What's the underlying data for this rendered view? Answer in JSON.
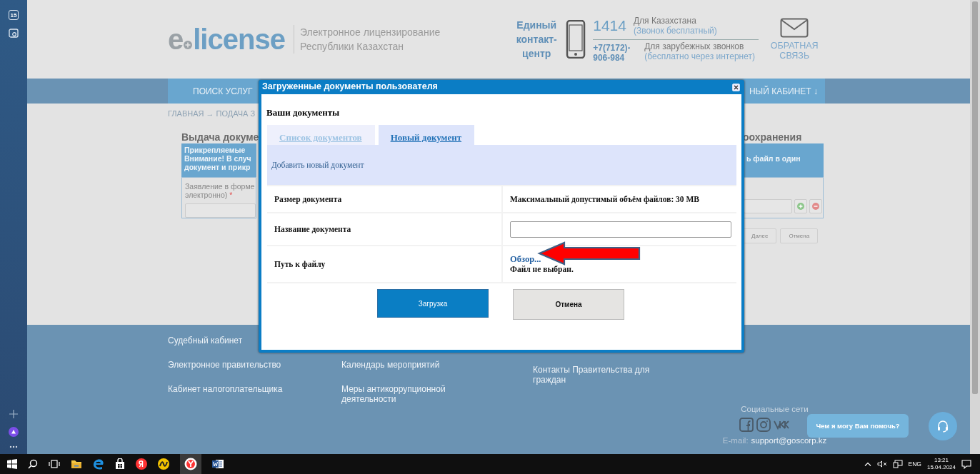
{
  "sidebar": {
    "badge": "15"
  },
  "header": {
    "logo": {
      "prefix": "e",
      "name": "license"
    },
    "subtitle": [
      "Электронное лицензирование",
      "Республики Казахстан"
    ],
    "contact": {
      "title": "Единый контакт-центр",
      "short_number": "1414",
      "short_note": "Для Казахстана",
      "short_hint": "(Звонок бесплатный)",
      "long_number": [
        "+7(7172)-",
        "906-984"
      ],
      "long_note": "Для зарубежных звонков",
      "long_hint": "(бесплатно через интернет)"
    },
    "feedback": "ОБРАТНАЯ СВЯЗЬ"
  },
  "nav": {
    "left": "ПОИСК УСЛУГ",
    "right": "НЫЙ КАБИНЕТ ↓"
  },
  "breadcrumb": "ГЛАВНАЯ → ПОДАЧА З",
  "background_form": {
    "left_title": "Выдача докуме",
    "left_notice": [
      "Прикрепляемые",
      "Внимание! В случ",
      "документ и прикр"
    ],
    "left_label": "Заявление в форме",
    "left_label_2": "электронно)",
    "required_mark": "*",
    "right_title": "оохранения",
    "right_notice": "ь файл в один",
    "buttons": [
      "Далее",
      "Отмена"
    ]
  },
  "modal": {
    "title": "Загруженные документы пользователя",
    "heading": "Ваши документы",
    "tabs": [
      {
        "label": "Список документов",
        "selected": false
      },
      {
        "label": "Новый документ",
        "selected": true
      }
    ],
    "panel_link": "Добавить новый документ",
    "rows": [
      {
        "kind": "text",
        "label": "Размер документа",
        "value": "Максимальный допустимый объём файлов: 30 MB"
      },
      {
        "kind": "input",
        "label": "Название документа"
      },
      {
        "kind": "file",
        "label": "Путь к файлу",
        "link": "Обзор...",
        "status": "Файл не выбран."
      }
    ],
    "buttons": [
      {
        "label": "Загрузка",
        "kind": "primary"
      },
      {
        "label": "Отмена",
        "kind": "secondary"
      }
    ]
  },
  "footer": {
    "columns": [
      [
        "Судебный кабинет",
        "Электронное правительство",
        "Кабинет налогоплательщика"
      ],
      [
        "Календарь мероприятий",
        "Меры антикоррупционной деятельности"
      ],
      [
        "Контакты Правительства для граждан"
      ]
    ],
    "social_title": "Социальные сети",
    "email_label": "E-mail:",
    "email": "support@goscorp.kz"
  },
  "chat": {
    "prompt": "Чем я могу Вам помочь?"
  },
  "taskbar": {
    "language": "ENG",
    "time": "13:21",
    "date": "15.04.2024"
  }
}
